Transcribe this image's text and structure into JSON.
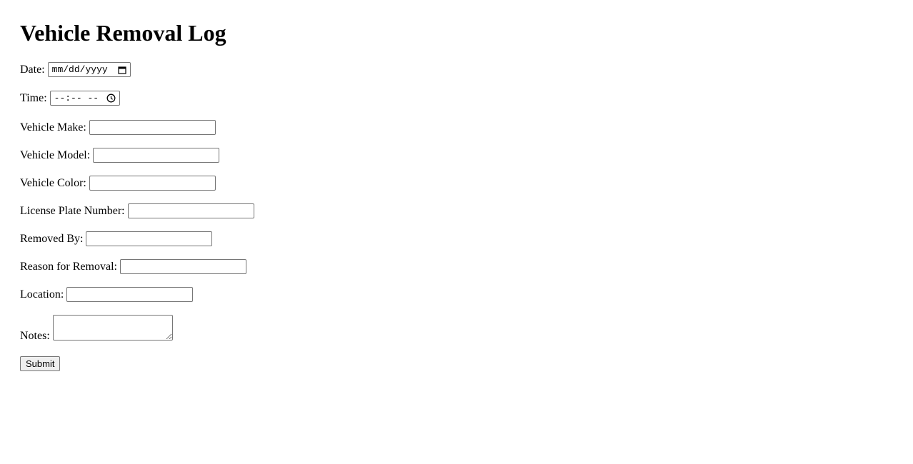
{
  "page": {
    "title": "Vehicle Removal Log"
  },
  "form": {
    "date": {
      "label": "Date:",
      "placeholder": "mm/dd/yyyy",
      "icon": "calendar-icon"
    },
    "time": {
      "label": "Time:",
      "placeholder": "--:-- --",
      "icon": "clock-icon"
    },
    "vehicle_make": {
      "label": "Vehicle Make:",
      "value": ""
    },
    "vehicle_model": {
      "label": "Vehicle Model:",
      "value": ""
    },
    "vehicle_color": {
      "label": "Vehicle Color:",
      "value": ""
    },
    "license_plate": {
      "label": "License Plate Number:",
      "value": ""
    },
    "removed_by": {
      "label": "Removed By:",
      "value": ""
    },
    "reason": {
      "label": "Reason for Removal:",
      "value": ""
    },
    "location": {
      "label": "Location:",
      "value": ""
    },
    "notes": {
      "label": "Notes:",
      "value": ""
    },
    "submit_label": "Submit"
  }
}
